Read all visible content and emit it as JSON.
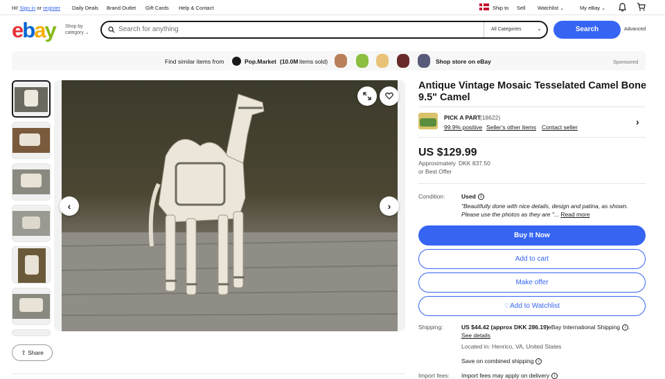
{
  "topbar": {
    "greeting": "Hi!",
    "sign_in": "Sign in",
    "or": "or",
    "register": "register",
    "nav": [
      "Daily Deals",
      "Brand Outlet",
      "Gift Cards",
      "Help & Contact"
    ],
    "ship_to": "Ship to",
    "sell": "Sell",
    "watchlist": "Watchlist",
    "my_ebay": "My eBay"
  },
  "header": {
    "logo": [
      "e",
      "b",
      "a",
      "y"
    ],
    "shop_by_line1": "Shop by",
    "shop_by_line2": "category",
    "search_placeholder": "Search for anything",
    "category": "All Categories",
    "search_button": "Search",
    "advanced": "Advanced"
  },
  "promo": {
    "find_similar": "Find similar items from",
    "store_name": "Pop.Market",
    "items_sold_count": "(10.0M",
    "items_sold_text": "items sold)",
    "shop_store": "Shop store on eBay",
    "sponsored": "Sponsored"
  },
  "item": {
    "title": "Antique Vintage Mosaic Tesselated Camel Bone 9.5\" Camel",
    "seller_name": "PICK A PART",
    "seller_feedback": "(18622)",
    "seller_positive": "99.9% positive",
    "seller_other": "Seller's other items",
    "contact_seller": "Contact seller",
    "price": "US $129.99",
    "approx_label": "Approximately",
    "approx_value": "DKK 837.50",
    "best_offer": "or Best Offer",
    "condition_label": "Condition:",
    "condition_value": "Used",
    "condition_quote": "\"Beautifully done with nice details, design and patina, as shown. Please use the photos as they are \"...",
    "read_more": "Read more",
    "buy_now": "Buy It Now",
    "add_to_cart": "Add to cart",
    "make_offer": "Make offer",
    "add_to_watchlist": "Add to Watchlist",
    "shipping_label": "Shipping:",
    "shipping_value": "US $44.42 (approx DKK 286.19)",
    "shipping_method": "eBay International Shipping",
    "see_details": "See details",
    "located": "Located in: Henrico, VA, United States",
    "combined": "Save on combined shipping",
    "import_label": "Import fees:",
    "import_value": "Import fees may apply on delivery"
  },
  "share_label": "Share",
  "colors": {
    "accent": "#3665f3",
    "logo_e": "#e53238",
    "logo_b": "#0064d2",
    "logo_a": "#f5af02",
    "logo_y": "#86b817"
  }
}
